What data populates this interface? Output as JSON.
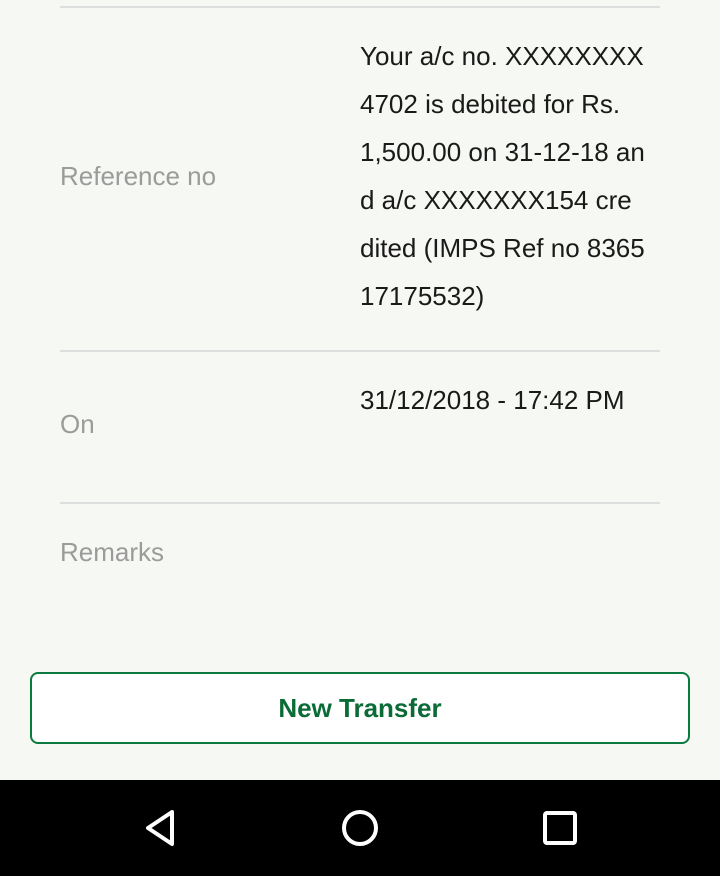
{
  "details": {
    "reference": {
      "label": "Reference no",
      "value": "Your a/c no. XXXXXXXX4702 is debited for Rs. 1,500.00 on 31-12-18 and a/c XXXXXXX154 credited (IMPS Ref no 836517175532)"
    },
    "on": {
      "label": "On",
      "value": "31/12/2018 - 17:42 PM"
    },
    "remarks": {
      "label": "Remarks",
      "value": ""
    }
  },
  "actions": {
    "new_transfer_label": "New Transfer"
  },
  "navbar": {
    "icons": [
      "back-triangle-icon",
      "home-circle-icon",
      "recents-square-icon"
    ]
  },
  "colors": {
    "accent": "#0b7a3e",
    "background": "#f6f8f3",
    "label_gray": "#9b9b9b"
  }
}
